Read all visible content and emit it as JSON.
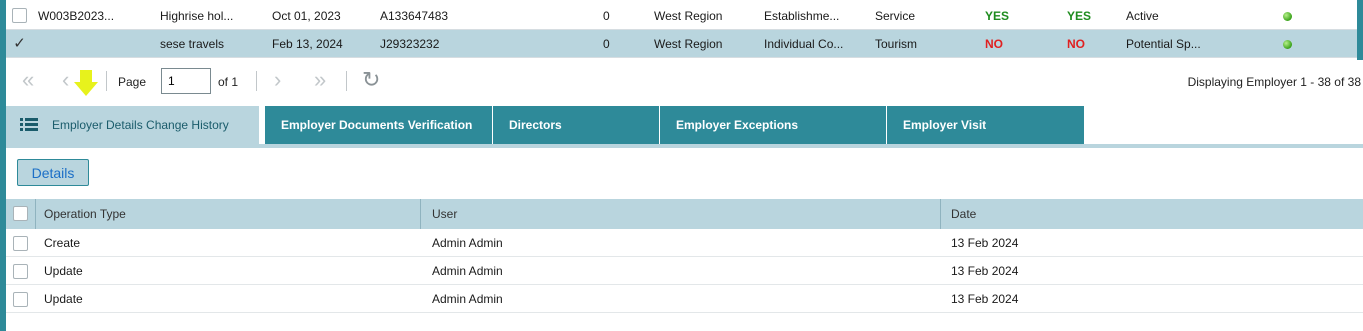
{
  "grid": {
    "rows": [
      {
        "checked": false,
        "code": "W003B2023...",
        "name": "Highrise hol...",
        "date": "Oct 01, 2023",
        "reg_no": "A133647483",
        "count": "0",
        "region": "West Region",
        "category": "Establishme...",
        "sector": "Service",
        "flag1": "YES",
        "flag2": "YES",
        "status": "Active",
        "status_color": "#3aa21a"
      },
      {
        "checked": true,
        "checkmark": "✓",
        "code": "",
        "name": "sese travels",
        "date": "Feb 13, 2024",
        "reg_no": "J29323232",
        "count": "0",
        "region": "West Region",
        "category": "Individual Co...",
        "sector": "Tourism",
        "flag1": "NO",
        "flag2": "NO",
        "status": "Potential Sp...",
        "status_color": "#3aa21a"
      }
    ]
  },
  "pager": {
    "first_icon": "double-chevron-left-icon",
    "first_glyph": "«",
    "prev_icon": "chevron-left-icon",
    "prev_glyph": "‹",
    "page_label": "Page",
    "page_value": "1",
    "of_label": "of 1",
    "next_icon": "chevron-right-icon",
    "next_glyph": "›",
    "last_icon": "double-chevron-right-icon",
    "last_glyph": "»",
    "refresh_icon": "refresh-icon",
    "refresh_glyph": "↻",
    "display_text": "Displaying Employer 1 - 38 of 38"
  },
  "tabs": [
    {
      "label": "Employer Details Change History",
      "active": true,
      "icon": "list-icon"
    },
    {
      "label": "Employer Documents Verification",
      "active": false
    },
    {
      "label": "Directors",
      "active": false
    },
    {
      "label": "Employer Exceptions",
      "active": false
    },
    {
      "label": "Employer Visit",
      "active": false
    }
  ],
  "toolbar": {
    "details_label": "Details"
  },
  "history_table": {
    "columns": [
      "Operation Type",
      "User",
      "Date"
    ],
    "rows": [
      {
        "operation": "Create",
        "user": "Admin Admin",
        "date": "13 Feb 2024"
      },
      {
        "operation": "Update",
        "user": "Admin Admin",
        "date": "13 Feb 2024"
      },
      {
        "operation": "Update",
        "user": "Admin Admin",
        "date": "13 Feb 2024"
      }
    ]
  },
  "colors": {
    "accent": "#2e8a99",
    "light_accent": "#b9d5de",
    "yes": "#1e8c1e",
    "no": "#e02020",
    "marker": "#e7f21c"
  }
}
